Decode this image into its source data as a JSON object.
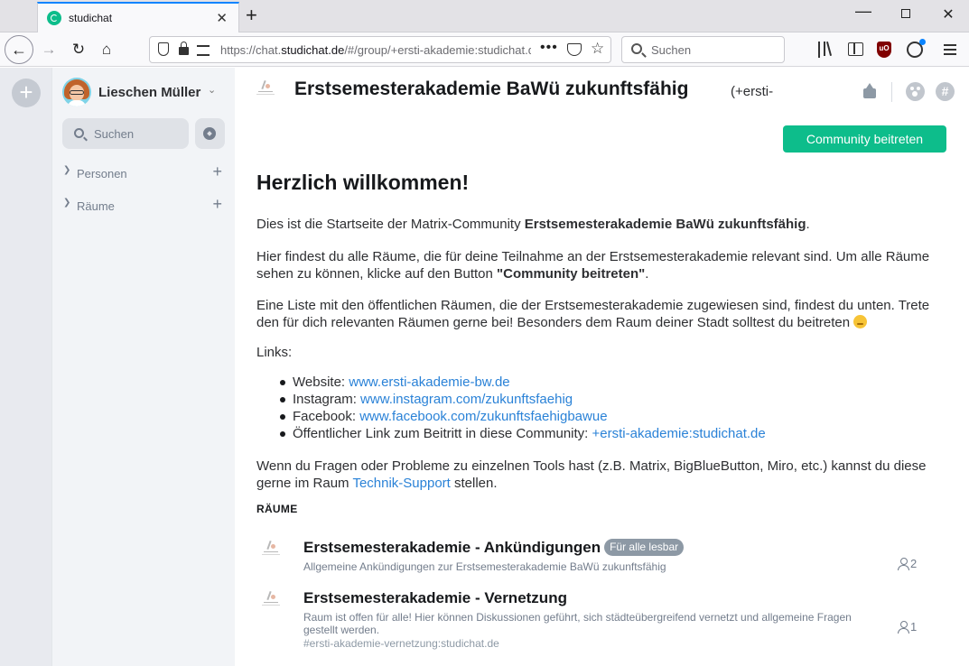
{
  "browser": {
    "tab_title": "studichat",
    "url_prefix": "https://chat.",
    "url_domain": "studichat.de",
    "url_suffix": "/#/group/+ersti-akademie:studichat.de",
    "search_placeholder": "Suchen",
    "ublock_label": "uO"
  },
  "app": {
    "user": {
      "name": "Lieschen Müller"
    },
    "search_label": "Suchen",
    "sections": [
      {
        "label": "Personen"
      },
      {
        "label": "Räume"
      }
    ],
    "accent_color": "#0dbd8b",
    "link_color": "#2a82d7"
  },
  "community": {
    "name": "Erstsemesterakademie BaWü zukunftsfähig",
    "alias": "(+ersti-",
    "join_label": "Community beitreten",
    "welcome_title": "Herzlich willkommen!",
    "intro_text": "Dies ist die Startseite der Matrix-Community ",
    "intro_bold": "Erstsemesterakademie BaWü zukunftsfähig",
    "intro_end": ".",
    "p2_text": "Hier findest du alle Räume, die für deine Teilnahme an der Erstsemesterakademie relevant sind. Um alle Räume sehen zu können, klicke auf den Button ",
    "p2_bold": "\"Community beitreten\"",
    "p2_end": ".",
    "p3_text": "Eine Liste mit den öffentlichen Räumen, die der Erstsemesterakademie zugewiesen sind, findest du unten. Trete den für dich relevanten Räumen gerne bei! Besonders dem Raum deiner Stadt solltest du beitreten ",
    "links_title": "Links:",
    "links": [
      {
        "label": "Website: ",
        "link": "www.ersti-akademie-bw.de"
      },
      {
        "label": "Instagram: ",
        "link": "www.instagram.com/zukunftsfaehig"
      },
      {
        "label": "Facebook: ",
        "link": "www.facebook.com/zukunftsfaehigbawue"
      },
      {
        "label": "Öffentlicher Link zum Beitritt in diese Community: ",
        "link": "+ersti-akademie:studichat.de"
      }
    ],
    "p5_text": "Wenn du Fragen oder Probleme zu einzelnen Tools hast (z.B. Matrix, BigBlueButton, Miro, etc.) kannst du diese gerne im Raum ",
    "p5_link": "Technik-Support",
    "p5_end": " stellen.",
    "rooms_heading": "RÄUME",
    "rooms": [
      {
        "name": "Erstsemesterakademie - Ankündigungen",
        "badge": "Für alle lesbar",
        "topic": "Allgemeine Ankündigungen zur Erstsemesterakademie BaWü zukunftsfähig",
        "alias": "",
        "members": "2"
      },
      {
        "name": "Erstsemesterakademie - Vernetzung",
        "badge": "",
        "topic": "Raum ist offen für alle! Hier können Diskussionen geführt, sich städteübergreifend vernetzt und allgemeine Fragen gestellt werden.",
        "alias": "#ersti-akademie-vernetzung:studichat.de",
        "members": "1"
      }
    ]
  }
}
